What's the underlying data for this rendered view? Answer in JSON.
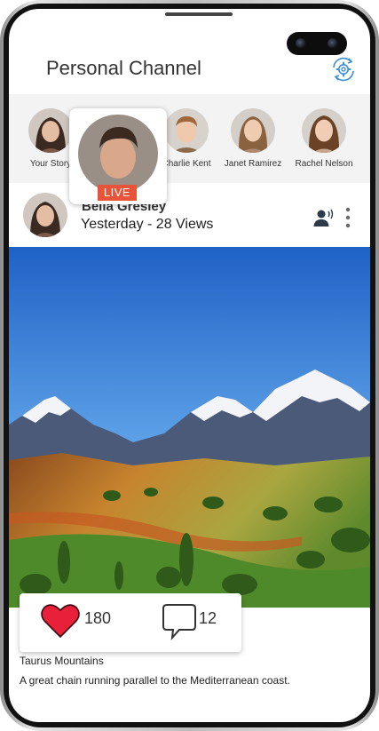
{
  "header": {
    "title": "Personal Channel"
  },
  "stories": [
    {
      "name": "Your Story"
    },
    {
      "name": "Charlie Kent"
    },
    {
      "name": "Janet Ramirez"
    },
    {
      "name": "Rachel Nelson"
    }
  ],
  "live": {
    "badge": "LIVE"
  },
  "post": {
    "author": "Bella Gresley",
    "meta": "Yesterday - 28 Views",
    "likes": "180",
    "comments": "12",
    "title": "Taurus Mountains",
    "caption": "A great chain running parallel to the Mediterranean coast."
  },
  "colors": {
    "live": "#e8533a",
    "heart": "#e8203a",
    "accent": "#3d8fd6"
  }
}
